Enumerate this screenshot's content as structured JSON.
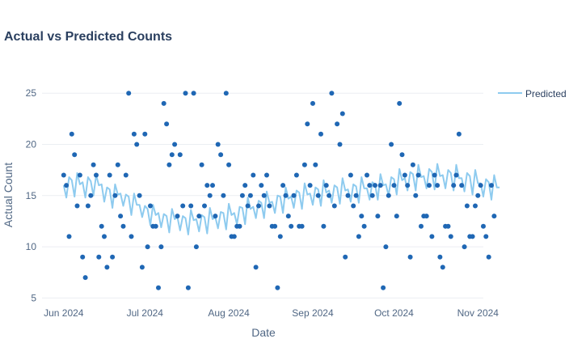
{
  "chart_data": {
    "type": "scatter",
    "title": "Actual vs Predicted Counts",
    "xlabel": "Date",
    "ylabel": "Actual Count",
    "xlim": [
      "2024-05-24",
      "2024-11-03"
    ],
    "ylim": [
      4.4,
      26.2
    ],
    "x_ticks": [
      {
        "date": "2024-06-01",
        "label": "Jun 2024"
      },
      {
        "date": "2024-07-01",
        "label": "Jul 2024"
      },
      {
        "date": "2024-08-01",
        "label": "Aug 2024"
      },
      {
        "date": "2024-09-01",
        "label": "Sep 2024"
      },
      {
        "date": "2024-10-01",
        "label": "Oct 2024"
      },
      {
        "date": "2024-11-01",
        "label": "Nov 2024"
      }
    ],
    "y_ticks": [
      5,
      10,
      15,
      20,
      25
    ],
    "grid": true,
    "legend": {
      "position": "top-right",
      "entries": [
        "Predicted"
      ]
    },
    "colors": {
      "actual": "#1f67b4",
      "predicted": "#8ecbef",
      "grid": "#ebeef2"
    },
    "series": [
      {
        "kind": "markers",
        "start": "2024-06-01",
        "values": [
          17,
          16,
          11,
          21,
          19,
          14,
          17,
          9,
          7,
          14,
          15,
          18,
          17,
          9,
          12,
          11,
          8,
          17,
          9,
          15,
          18,
          13,
          12,
          17,
          25,
          11,
          21,
          20,
          15,
          8,
          21,
          10,
          14,
          12,
          12,
          6,
          10,
          24,
          22,
          18,
          19,
          20,
          13,
          19,
          14,
          25,
          6,
          14,
          25,
          10,
          13,
          18,
          14,
          16,
          15,
          16,
          13,
          20,
          19,
          15,
          25,
          18,
          11,
          11,
          12,
          12,
          15,
          16,
          14,
          15,
          17,
          8,
          14,
          16,
          15,
          17,
          14,
          12,
          12,
          6,
          11,
          16,
          15,
          13,
          12,
          15,
          17,
          12,
          12,
          18,
          22,
          16,
          24,
          18,
          15,
          21,
          12,
          16,
          15,
          25,
          14,
          22,
          20,
          23,
          9,
          15,
          17,
          14,
          15,
          11,
          13,
          12,
          17,
          16,
          15,
          16,
          13,
          16,
          6,
          10,
          15,
          20,
          16,
          13,
          24,
          19,
          17,
          16,
          9,
          18,
          15,
          17,
          12,
          13,
          13,
          16,
          11,
          17,
          16,
          9,
          8,
          12,
          12,
          11,
          16,
          17,
          21,
          16,
          10,
          14,
          11,
          11,
          14,
          15,
          16,
          12,
          11,
          9,
          16,
          13
        ]
      },
      {
        "name": "Predicted",
        "kind": "line",
        "start": "2024-06-01",
        "values": [
          16.0,
          14.8,
          16.8,
          16.5,
          14.9,
          17.2,
          16.1,
          16.3,
          14.8,
          16.8,
          16.4,
          15.0,
          17.0,
          16.0,
          16.1,
          14.4,
          15.8,
          15.6,
          13.8,
          16.1,
          15.1,
          15.2,
          14.0,
          15.1,
          14.9,
          13.1,
          15.2,
          14.1,
          14.1,
          12.9,
          14.0,
          13.7,
          12.1,
          14.1,
          13.1,
          13.3,
          11.9,
          13.2,
          13.0,
          11.4,
          13.7,
          12.7,
          12.9,
          11.6,
          13.0,
          12.8,
          11.2,
          13.6,
          12.6,
          12.7,
          11.5,
          13.1,
          12.9,
          11.3,
          13.8,
          12.7,
          12.9,
          11.8,
          13.4,
          13.3,
          11.7,
          14.2,
          13.1,
          13.3,
          12.2,
          13.9,
          13.8,
          12.2,
          14.8,
          13.7,
          13.9,
          12.8,
          14.5,
          14.3,
          12.8,
          15.4,
          14.3,
          14.4,
          13.3,
          15.0,
          14.9,
          13.3,
          15.8,
          14.7,
          14.9,
          13.8,
          15.5,
          15.3,
          13.7,
          16.2,
          15.1,
          15.2,
          14.1,
          15.8,
          15.6,
          14.0,
          16.5,
          15.3,
          15.5,
          14.3,
          16.0,
          15.8,
          14.2,
          16.7,
          15.5,
          15.6,
          14.4,
          16.1,
          15.9,
          14.3,
          16.8,
          15.7,
          15.7,
          14.6,
          16.3,
          16.1,
          14.6,
          17.1,
          16.0,
          16.1,
          15.0,
          16.8,
          16.6,
          15.1,
          17.6,
          16.5,
          16.7,
          15.5,
          17.3,
          17.1,
          15.5,
          18.0,
          16.8,
          16.9,
          15.7,
          17.6,
          17.3,
          15.6,
          18.1,
          16.9,
          17.0,
          15.7,
          17.5,
          17.2,
          15.5,
          18.0,
          16.7,
          16.7,
          15.4,
          17.2,
          16.9,
          15.1,
          17.5,
          16.2,
          16.2,
          14.9,
          16.6,
          16.3,
          14.6,
          17.0,
          15.8,
          15.8
        ]
      }
    ]
  }
}
